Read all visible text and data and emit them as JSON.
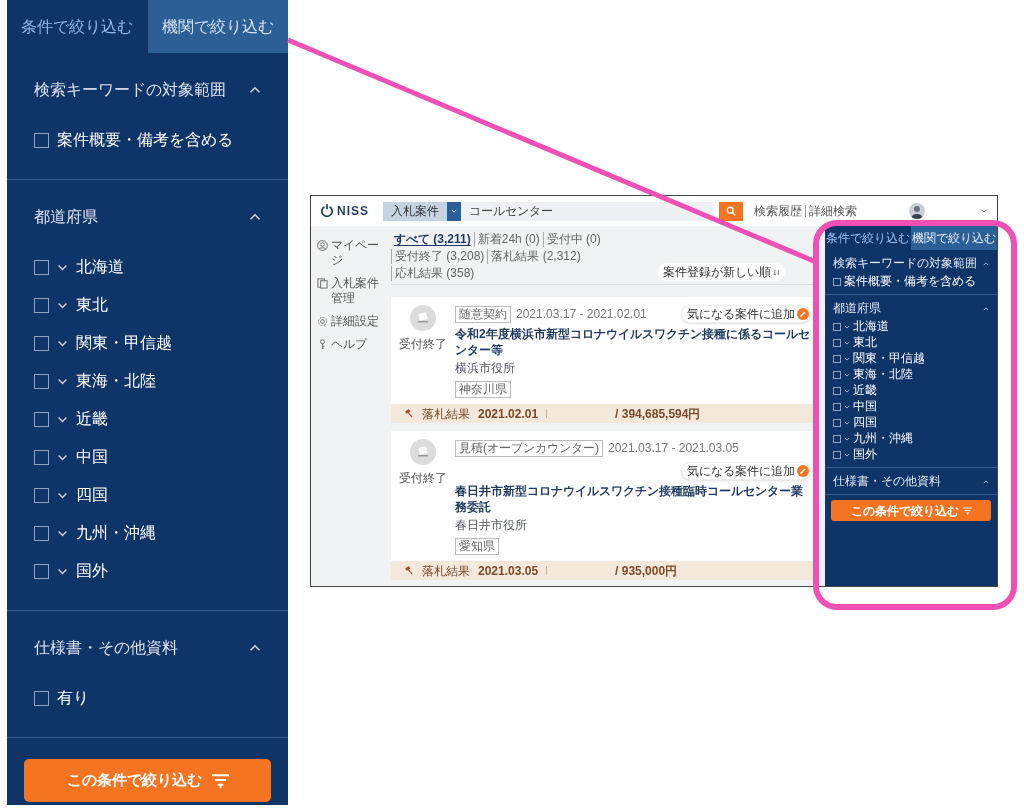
{
  "filter_panel": {
    "tabs": [
      {
        "label": "条件で絞り込む",
        "selected": true
      },
      {
        "label": "機関で絞り込む",
        "selected": false
      }
    ],
    "sections": [
      {
        "title": "検索キーワードの対象範囲",
        "expanded": true,
        "options": [
          {
            "label": "案件概要・備考を含める",
            "checked": false,
            "expandable": false
          }
        ]
      },
      {
        "title": "都道府県",
        "expanded": true,
        "options": [
          {
            "label": "北海道",
            "checked": false,
            "expandable": true
          },
          {
            "label": "東北",
            "checked": false,
            "expandable": true
          },
          {
            "label": "関東・甲信越",
            "checked": false,
            "expandable": true
          },
          {
            "label": "東海・北陸",
            "checked": false,
            "expandable": true
          },
          {
            "label": "近畿",
            "checked": false,
            "expandable": true
          },
          {
            "label": "中国",
            "checked": false,
            "expandable": true
          },
          {
            "label": "四国",
            "checked": false,
            "expandable": true
          },
          {
            "label": "九州・沖縄",
            "checked": false,
            "expandable": true
          },
          {
            "label": "国外",
            "checked": false,
            "expandable": true
          }
        ]
      },
      {
        "title": "仕様書・その他資料",
        "expanded": true,
        "options": [
          {
            "label": "有り",
            "checked": false,
            "expandable": false
          }
        ]
      }
    ],
    "apply_button": "この条件で絞り込む"
  },
  "screenshot": {
    "logo": "NISS",
    "search": {
      "category": "入札案件",
      "query": "コールセンター"
    },
    "header_links": [
      "検索履歴",
      "詳細検索"
    ],
    "nav": [
      {
        "label": "マイページ",
        "kind": "user"
      },
      {
        "label": "入札案件管理",
        "kind": "docs"
      },
      {
        "label": "詳細設定",
        "kind": "gear"
      },
      {
        "label": "ヘルプ",
        "kind": "key"
      }
    ],
    "filter_tabs": [
      {
        "label": "すべて (3,211)",
        "selected": true
      },
      {
        "label": "新着24h (0)",
        "selected": false
      },
      {
        "label": "受付中 (0)",
        "selected": false
      },
      {
        "label": "受付終了 (3,208)",
        "selected": false
      },
      {
        "label": "落札結果 (2,312)",
        "selected": false
      },
      {
        "label": "応札結果 (358)",
        "selected": false
      }
    ],
    "sort": "案件登録が新しい順",
    "cards": [
      {
        "status": "受付終了",
        "type": "随意契約",
        "period": "2021.03.17 - 2021.02.01",
        "title": "令和2年度横浜市新型コロナウイルスワクチン接種に係るコールセンター等",
        "organization": "横浜市役所",
        "region": "神奈川県",
        "favorite": "気になる案件に追加",
        "result": {
          "label": "落札結果",
          "date": "2021.02.01",
          "amount": "/ 394,685,594円"
        }
      },
      {
        "status": "受付終了",
        "type": "見積(オープンカウンター)",
        "period": "2021.03.17 - 2021.03.05",
        "title": "春日井市新型コロナウイルスワクチン接種臨時コールセンター業務委託",
        "organization": "春日井市役所",
        "region": "愛知県",
        "favorite": "気になる案件に追加",
        "result": {
          "label": "落札結果",
          "date": "2021.03.05",
          "amount": "/ 935,000円"
        }
      }
    ],
    "sidebar": {
      "tabs": [
        {
          "label": "条件で絞り込む",
          "selected": true
        },
        {
          "label": "機関で絞り込む",
          "selected": false
        }
      ],
      "sections": [
        {
          "title": "検索キーワードの対象範囲",
          "expanded": true,
          "options": [
            {
              "label": "案件概要・備考を含める",
              "checked": false,
              "expandable": false
            }
          ]
        },
        {
          "title": "都道府県",
          "expanded": true,
          "options": [
            {
              "label": "北海道",
              "checked": false,
              "expandable": true
            },
            {
              "label": "東北",
              "checked": false,
              "expandable": true
            },
            {
              "label": "関東・甲信越",
              "checked": false,
              "expandable": true
            },
            {
              "label": "東海・北陸",
              "checked": false,
              "expandable": true
            },
            {
              "label": "近畿",
              "checked": false,
              "expandable": true
            },
            {
              "label": "中国",
              "checked": false,
              "expandable": true
            },
            {
              "label": "四国",
              "checked": false,
              "expandable": true
            },
            {
              "label": "九州・沖縄",
              "checked": false,
              "expandable": true
            },
            {
              "label": "国外",
              "checked": false,
              "expandable": true
            }
          ]
        },
        {
          "title": "仕様書・その他資料",
          "expanded": true
        }
      ],
      "apply_button": "この条件で絞り込む"
    }
  }
}
